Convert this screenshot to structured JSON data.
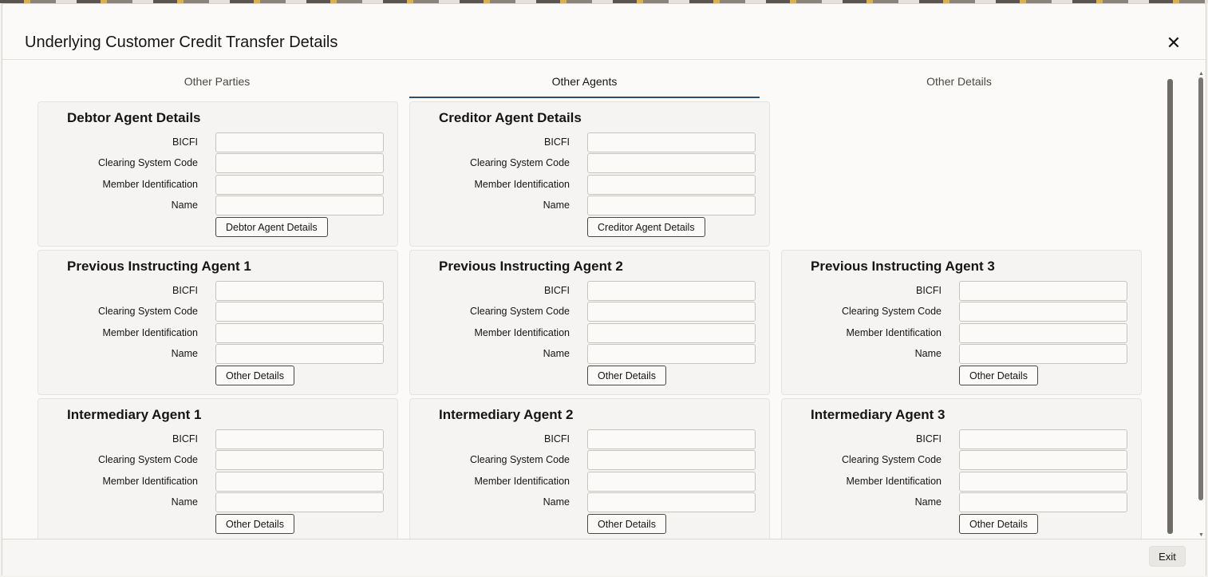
{
  "dialog": {
    "title": "Underlying Customer Credit Transfer Details",
    "close_icon": "close-icon"
  },
  "tabs": [
    {
      "label": "Other Parties",
      "active": false
    },
    {
      "label": "Other Agents",
      "active": true
    },
    {
      "label": "Other Details",
      "active": false
    }
  ],
  "field_labels": {
    "bicfi": "BICFI",
    "clearing": "Clearing System Code",
    "member": "Member Identification",
    "name": "Name"
  },
  "panels": {
    "debtor": {
      "title": "Debtor Agent Details",
      "button": "Debtor Agent Details"
    },
    "creditor": {
      "title": "Creditor Agent Details",
      "button": "Creditor Agent Details"
    },
    "prev1": {
      "title": "Previous Instructing Agent 1",
      "button": "Other Details"
    },
    "prev2": {
      "title": "Previous Instructing Agent 2",
      "button": "Other Details"
    },
    "prev3": {
      "title": "Previous Instructing Agent 3",
      "button": "Other Details"
    },
    "inter1": {
      "title": "Intermediary Agent 1",
      "button": "Other Details"
    },
    "inter2": {
      "title": "Intermediary Agent 2",
      "button": "Other Details"
    },
    "inter3": {
      "title": "Intermediary Agent 3",
      "button": "Other Details"
    }
  },
  "fields": {
    "bicfi": "",
    "clearing": "",
    "member": "",
    "name": ""
  },
  "footer": {
    "exit_label": "Exit"
  },
  "colors": {
    "accent": "#2e4f6b",
    "background": "#fbfaf8",
    "panel": "#f5f4f2"
  }
}
